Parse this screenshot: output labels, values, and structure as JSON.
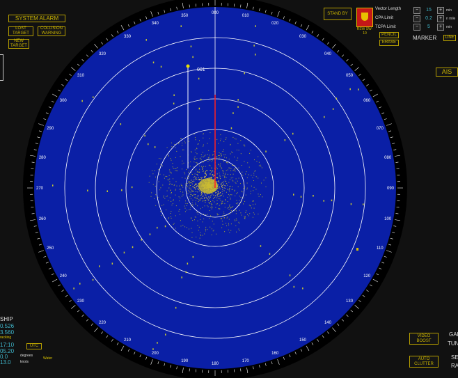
{
  "alarms": {
    "system_alarm": "SYSTEM ALARM",
    "lost_target": "LOST TARGET",
    "collision_warning": "COLLISION WARNING",
    "new_target": "NEW TARGET"
  },
  "top_right": {
    "stand_by": "STAND BY",
    "ship_id": "RSW SW-10",
    "vector_length_label": "Vector Length",
    "vector_length_value": "15",
    "vector_length_unit": "min",
    "cpa_label": "CPA Limit",
    "cpa_value": "0.2",
    "cpa_unit": "n mile",
    "tcpa_label": "TCPA Limit",
    "tcpa_value": "5",
    "tcpa_unit": "min",
    "pencil": "PENCIL",
    "erase": "ERASE",
    "marker_label": "MARKER",
    "line": "LINE",
    "ais": "AIS"
  },
  "bearings": [
    "000",
    "010",
    "020",
    "030",
    "040",
    "050",
    "060",
    "070",
    "080",
    "090",
    "100",
    "110",
    "120",
    "130",
    "140",
    "150",
    "160",
    "170",
    "180",
    "190",
    "200",
    "210",
    "220",
    "230",
    "240",
    "250",
    "260",
    "270",
    "280",
    "290",
    "300",
    "310",
    "320",
    "330",
    "340",
    "350"
  ],
  "target": {
    "label": "001"
  },
  "own_ship": {
    "title": "SHIP",
    "lat": "0.526",
    "lon": "3.560",
    "mode": "racking",
    "time": "17:10",
    "val2": "05.20",
    "speed": "0.0",
    "speed_unit": "degrees",
    "heading": "13.0",
    "heading_unit": "knots",
    "utc": "UTC",
    "water": "Water"
  },
  "bottom_right": {
    "video_boost": "VIDEO BOOST",
    "auto_clutter": "AUTO CLUTTER",
    "gain_partial": "GAI",
    "tune_partial": "TUN",
    "sea_partial": "SE",
    "rain_partial": "RA"
  },
  "colors": {
    "scope": "#0a1fa6",
    "accent": "#c9b300",
    "echo": "#c8c830",
    "heading_line": "#ff2020"
  }
}
